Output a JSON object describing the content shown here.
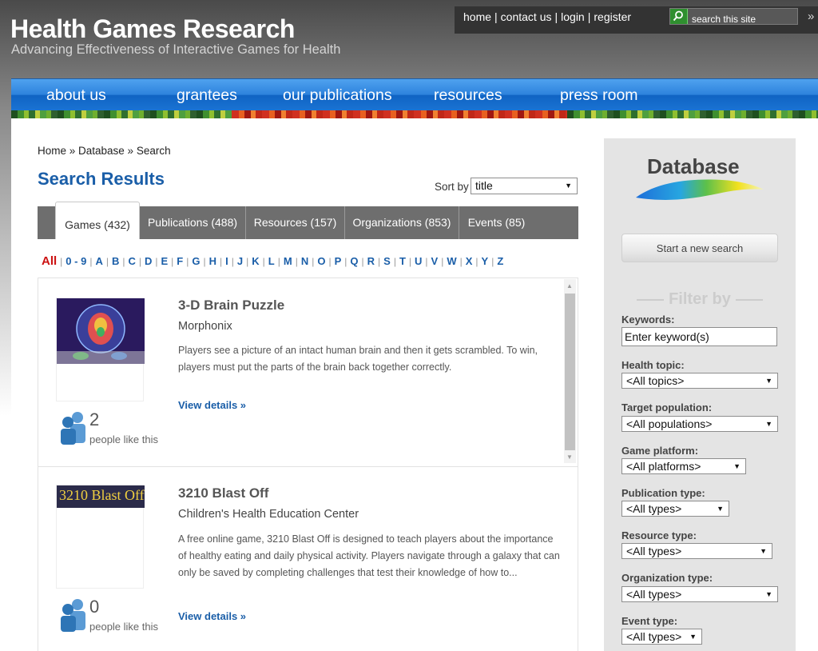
{
  "header": {
    "site_title": "Health Games Research",
    "tagline": "Advancing Effectiveness of Interactive Games for Health",
    "top_links": [
      "home",
      "contact us",
      "login",
      "register"
    ],
    "search_placeholder": "search this site",
    "expand_glyph": "»"
  },
  "nav": {
    "items": [
      "about us",
      "grantees",
      "our publications",
      "resources",
      "press room"
    ]
  },
  "breadcrumb": "Home » Database » Search",
  "page_title": "Search Results",
  "sort": {
    "label": "Sort by",
    "value": "title"
  },
  "tabs": [
    {
      "label": "Games (432)",
      "active": true
    },
    {
      "label": "Publications (488)",
      "active": false
    },
    {
      "label": "Resources (157)",
      "active": false
    },
    {
      "label": "Organizations (853)",
      "active": false
    },
    {
      "label": "Events (85)",
      "active": false
    }
  ],
  "alphabet": [
    "All",
    "0 - 9",
    "A",
    "B",
    "C",
    "D",
    "E",
    "F",
    "G",
    "H",
    "I",
    "J",
    "K",
    "L",
    "M",
    "N",
    "O",
    "P",
    "Q",
    "R",
    "S",
    "T",
    "U",
    "V",
    "W",
    "X",
    "Y",
    "Z"
  ],
  "results": [
    {
      "title": "3-D Brain Puzzle",
      "organization": "Morphonix",
      "description": "Players see a picture of an intact human brain and then it gets scrambled. To win, players must put the parts of the brain back together correctly.",
      "link": "View details »",
      "likes": "2",
      "likes_text": "people like this"
    },
    {
      "title": "3210 Blast Off",
      "organization": "Children's Health Education Center",
      "description": "A free online game, 3210 Blast Off is designed to teach players about the importance of healthy eating and daily physical activity. Players navigate through a galaxy that can only be saved by completing challenges that test their knowledge of how to...",
      "link": "View details »",
      "likes": "0",
      "likes_text": "people like this",
      "thumb_text": "3210 Blast Off"
    }
  ],
  "sidebar": {
    "database_title": "Database",
    "new_search": "Start a new search",
    "filter_heading": "Filter by",
    "keywords_label": "Keywords:",
    "keywords_placeholder": "Enter keyword(s)",
    "filters": [
      {
        "label": "Health topic:",
        "value": "<All topics>"
      },
      {
        "label": "Target population:",
        "value": "<All populations>"
      },
      {
        "label": "Game platform:",
        "value": "<All platforms>"
      },
      {
        "label": "Publication type:",
        "value": "<All types>"
      },
      {
        "label": "Resource type:",
        "value": "<All types>"
      },
      {
        "label": "Organization type:",
        "value": "<All types>"
      },
      {
        "label": "Event type:",
        "value": "<All types>"
      }
    ]
  },
  "colors": {
    "nav_blue": "#1a73d3",
    "link_blue": "#1a5ea8",
    "active_letter": "#cc1111",
    "search_green": "#2f8f2f"
  }
}
